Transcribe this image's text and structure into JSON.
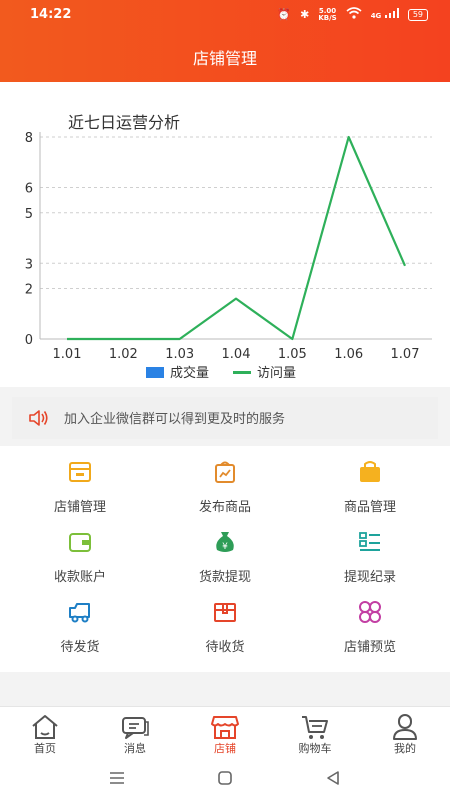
{
  "status_bar": {
    "time": "14:22",
    "net_speed": "5.00",
    "net_unit": "KB/S",
    "signal": "4G",
    "battery": "59"
  },
  "header": {
    "title": "店铺管理"
  },
  "chart_data": {
    "type": "line",
    "title": "近七日运营分析",
    "categories": [
      "1.01",
      "1.02",
      "1.03",
      "1.04",
      "1.05",
      "1.06",
      "1.07"
    ],
    "y_ticks": [
      0,
      2,
      3,
      5,
      6,
      8
    ],
    "ylim": [
      0,
      8
    ],
    "grid": true,
    "legend_position": "bottom",
    "series": [
      {
        "name": "成交量",
        "color": "#2a82e4",
        "values": []
      },
      {
        "name": "访问量",
        "color": "#2eb05a",
        "values": [
          0,
          0,
          0,
          1.6,
          0,
          8,
          2.9
        ]
      }
    ]
  },
  "notice": {
    "text": "加入企业微信群可以得到更及时的服务",
    "icon": "speaker-icon"
  },
  "menu": {
    "items": [
      {
        "label": "店铺管理",
        "icon": "shop-icon",
        "color": "#f1a91b"
      },
      {
        "label": "发布商品",
        "icon": "publish-icon",
        "color": "#e28b2c"
      },
      {
        "label": "商品管理",
        "icon": "bag-icon",
        "color": "#f5b11f"
      },
      {
        "label": "收款账户",
        "icon": "wallet-icon",
        "color": "#7cbf3a"
      },
      {
        "label": "货款提现",
        "icon": "money-bag-icon",
        "color": "#2e9d57"
      },
      {
        "label": "提现纪录",
        "icon": "list-icon",
        "color": "#1ea39c"
      },
      {
        "label": "待发货",
        "icon": "truck-icon",
        "color": "#1e7fc5"
      },
      {
        "label": "待收货",
        "icon": "box-icon",
        "color": "#e5452a"
      },
      {
        "label": "店铺预览",
        "icon": "grid-icon",
        "color": "#c23ea3"
      }
    ]
  },
  "tabbar": {
    "active": 2,
    "active_color": "#e5452a",
    "items": [
      {
        "label": "首页",
        "icon": "home-icon"
      },
      {
        "label": "消息",
        "icon": "message-icon"
      },
      {
        "label": "店铺",
        "icon": "store-icon"
      },
      {
        "label": "购物车",
        "icon": "cart-icon"
      },
      {
        "label": "我的",
        "icon": "user-icon"
      }
    ]
  }
}
